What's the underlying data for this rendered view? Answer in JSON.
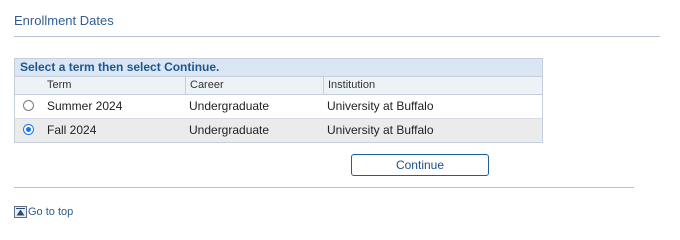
{
  "page": {
    "title": "Enrollment Dates"
  },
  "grid": {
    "caption": "Select a term then select Continue.",
    "columns": [
      "Term",
      "Career",
      "Institution"
    ],
    "rows": [
      {
        "term": "Summer 2024",
        "career": "Undergraduate",
        "institution": "University at Buffalo",
        "selected": false
      },
      {
        "term": "Fall 2024",
        "career": "Undergraduate",
        "institution": "University at Buffalo",
        "selected": true
      }
    ]
  },
  "actions": {
    "continue_label": "Continue"
  },
  "footer": {
    "go_to_top_label": "Go to top"
  },
  "colors": {
    "accent": "#1a73e8",
    "title": "#325e8f",
    "caption_bg": "#dbe6f3",
    "link": "#2a5c94"
  }
}
